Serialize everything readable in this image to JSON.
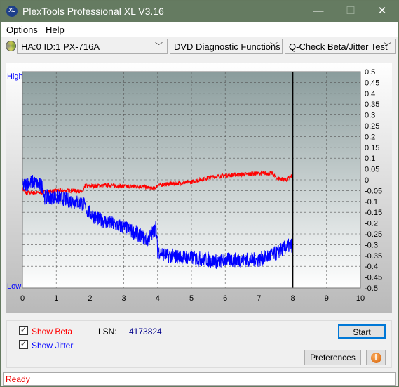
{
  "window": {
    "title": "PlexTools Professional XL V3.16",
    "logo_text": "XL",
    "minimize": "—",
    "maximize": "☐",
    "close": "✕"
  },
  "menu": {
    "items": [
      "Options",
      "Help"
    ]
  },
  "toolbar": {
    "drive": "HA:0 ID:1  PX-716A",
    "function": "DVD Diagnostic Functions",
    "test": "Q-Check Beta/Jitter Test"
  },
  "chart_data": {
    "type": "line",
    "xlim": [
      0,
      10
    ],
    "ylim": [
      -0.5,
      0.5
    ],
    "x_ticks": [
      "0",
      "1",
      "2",
      "3",
      "4",
      "5",
      "6",
      "7",
      "8",
      "9",
      "10"
    ],
    "y_ticks": [
      "0.5",
      "0.45",
      "0.4",
      "0.35",
      "0.3",
      "0.25",
      "0.2",
      "0.15",
      "0.1",
      "0.05",
      "0",
      "-0.05",
      "-0.1",
      "-0.15",
      "-0.2",
      "-0.25",
      "-0.3",
      "-0.35",
      "-0.4",
      "-0.45",
      "-0.5"
    ],
    "y_left_top": "High",
    "y_left_bottom": "Low",
    "grid": true,
    "marker_x": 8,
    "series": [
      {
        "name": "Beta",
        "color": "#ff0000",
        "x": [
          0,
          0.1,
          0.5,
          1,
          1.5,
          1.8,
          1.85,
          2.5,
          3,
          3.5,
          3.9,
          4.0,
          4.3,
          5,
          5.5,
          6,
          6.5,
          7,
          7.4,
          7.5,
          7.8,
          8
        ],
        "y": [
          -0.04,
          -0.06,
          -0.06,
          -0.05,
          -0.05,
          -0.055,
          -0.03,
          -0.025,
          -0.03,
          -0.03,
          -0.04,
          -0.025,
          -0.02,
          -0.01,
          0.01,
          0.02,
          0.025,
          0.03,
          0.03,
          0.01,
          0.0,
          0.02
        ],
        "spread": 0.01
      },
      {
        "name": "Jitter",
        "color": "#0000ff",
        "x": [
          0,
          0.1,
          0.3,
          0.6,
          0.65,
          1,
          1.5,
          1.8,
          1.9,
          2.2,
          2.6,
          3,
          3.4,
          3.7,
          3.95,
          4.0,
          4.3,
          5,
          5.5,
          5.8,
          6,
          6.5,
          7,
          7.5,
          7.8,
          8
        ],
        "y": [
          -0.03,
          -0.02,
          -0.01,
          -0.03,
          -0.08,
          -0.08,
          -0.1,
          -0.11,
          -0.14,
          -0.18,
          -0.2,
          -0.22,
          -0.25,
          -0.28,
          -0.22,
          -0.33,
          -0.35,
          -0.36,
          -0.37,
          -0.38,
          -0.37,
          -0.37,
          -0.37,
          -0.34,
          -0.31,
          -0.3
        ],
        "spread": 0.035
      }
    ]
  },
  "panel": {
    "show_beta": "Show Beta",
    "show_jitter": "Show Jitter",
    "show_beta_checked": true,
    "show_jitter_checked": true,
    "lsn_label": "LSN:",
    "lsn_value": "4173824",
    "start": "Start",
    "preferences": "Preferences",
    "info_icon": "info-icon"
  },
  "status": {
    "text": "Ready"
  }
}
